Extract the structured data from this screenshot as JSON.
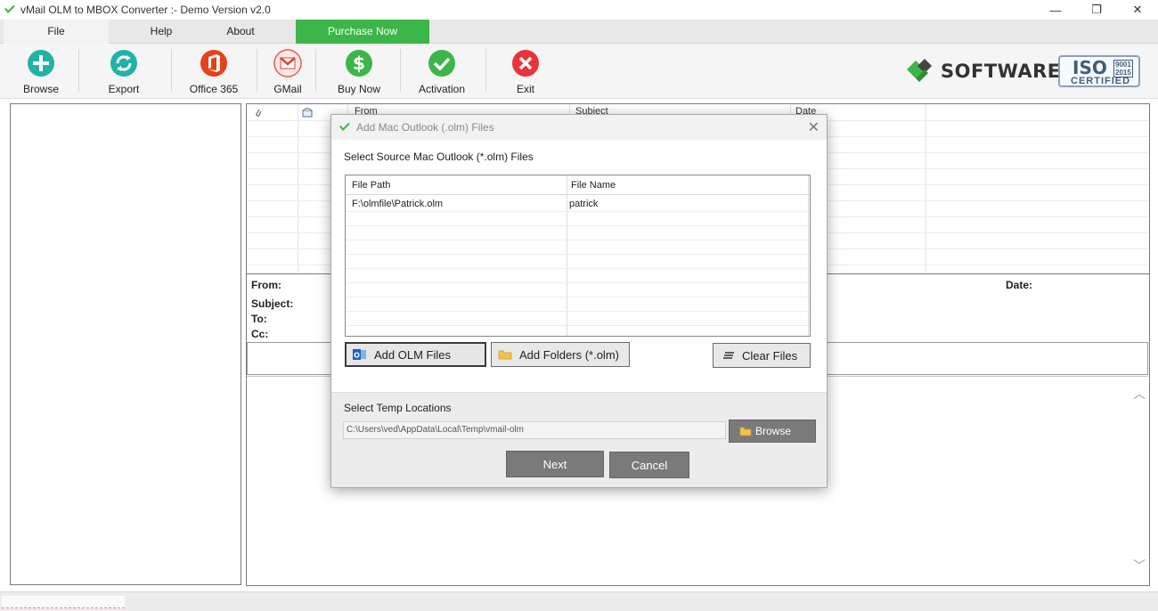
{
  "window": {
    "title": "vMail OLM to MBOX Converter :- Demo Version v2.0",
    "controls": {
      "minimize": "—",
      "restore": "❐",
      "close": "✕"
    }
  },
  "menu": {
    "file": "File",
    "help": "Help",
    "about": "About",
    "purchase": "Purchase Now"
  },
  "toolbar": {
    "browse": "Browse",
    "export": "Export",
    "office365": "Office 365",
    "gmail": "GMail",
    "buy_now": "Buy Now",
    "activation": "Activation",
    "exit": "Exit"
  },
  "brand": {
    "software": "SOFTWARE",
    "iso": "ISO",
    "iso_numbers": "9001\n2015",
    "certified": "CERTIFIED"
  },
  "mail_list": {
    "columns": [
      "From",
      "Subject",
      "Date"
    ]
  },
  "preview": {
    "from_label": "From:",
    "date_label": "Date:",
    "subject_label": "Subject:",
    "to_label": "To:",
    "cc_label": "Cc:"
  },
  "dialog": {
    "title": "Add Mac Outlook (.olm) Files",
    "close": "✕",
    "select_label": "Select Source Mac Outlook (*.olm) Files",
    "columns": {
      "path": "File Path",
      "name": "File Name"
    },
    "files": [
      {
        "path": "F:\\olmfile\\Patrick.olm",
        "name": "patrick"
      }
    ],
    "add_olm": "Add OLM Files",
    "add_folders": "Add Folders (*.olm)",
    "clear_files": "Clear Files",
    "temp_label": "Select Temp Locations",
    "temp_path": "C:\\Users\\ved\\AppData\\Local\\Temp\\vmail-olm",
    "browse": "Browse",
    "next": "Next",
    "cancel": "Cancel"
  },
  "colors": {
    "purchase_bg": "#3cb648",
    "brand_green": "#3cb648",
    "teal": "#21b3a7",
    "office_red": "#e5411a",
    "exit_red": "#e8343a",
    "button_gray": "#7a7a7a"
  }
}
